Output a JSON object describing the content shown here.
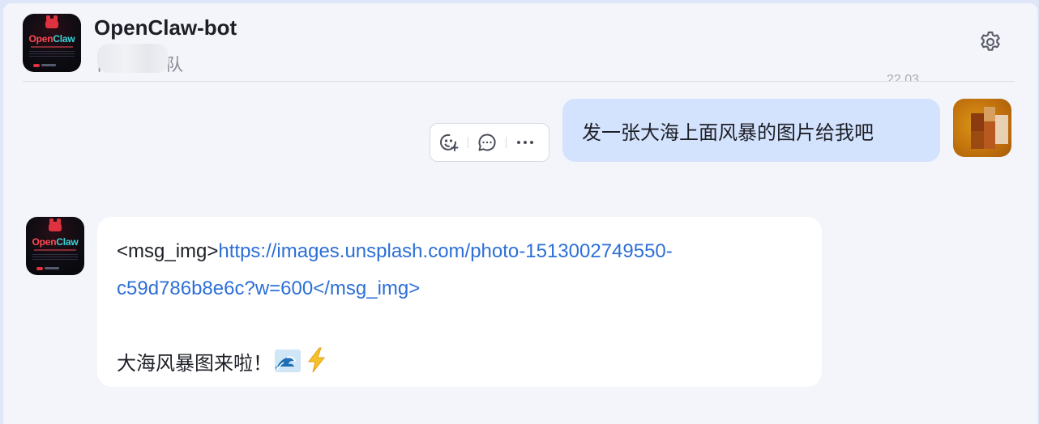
{
  "header": {
    "title": "OpenClaw-bot",
    "subtitle_visible_char_start": "卜",
    "subtitle_visible_char_end": "队",
    "settings_icon": "gear-icon"
  },
  "bot_avatar": {
    "logo_part1": "Open",
    "logo_part2": "Claw"
  },
  "time_fragment": "22 03",
  "messages": {
    "user": {
      "text": "发一张大海上面风暴的图片给我吧"
    },
    "actions": [
      {
        "icon": "add-reaction-icon"
      },
      {
        "icon": "reply-comment-icon"
      },
      {
        "icon": "more-options-icon"
      }
    ],
    "bot": {
      "line1_tag_open": "<msg_img>",
      "line1_url": "https://images.unsplash.com/photo-1513002749550-",
      "line2_url": "c59d786b8e6c?w=600</msg_img>",
      "line3_text": "大海风暴图来啦！",
      "emoji_1": "ocean-wave-emoji",
      "emoji_2": "lightning-emoji"
    }
  },
  "colors": {
    "accent_link": "#2d6fd6",
    "user_bubble": "#d3e2fd",
    "page_bg": "#f4f5fa"
  }
}
